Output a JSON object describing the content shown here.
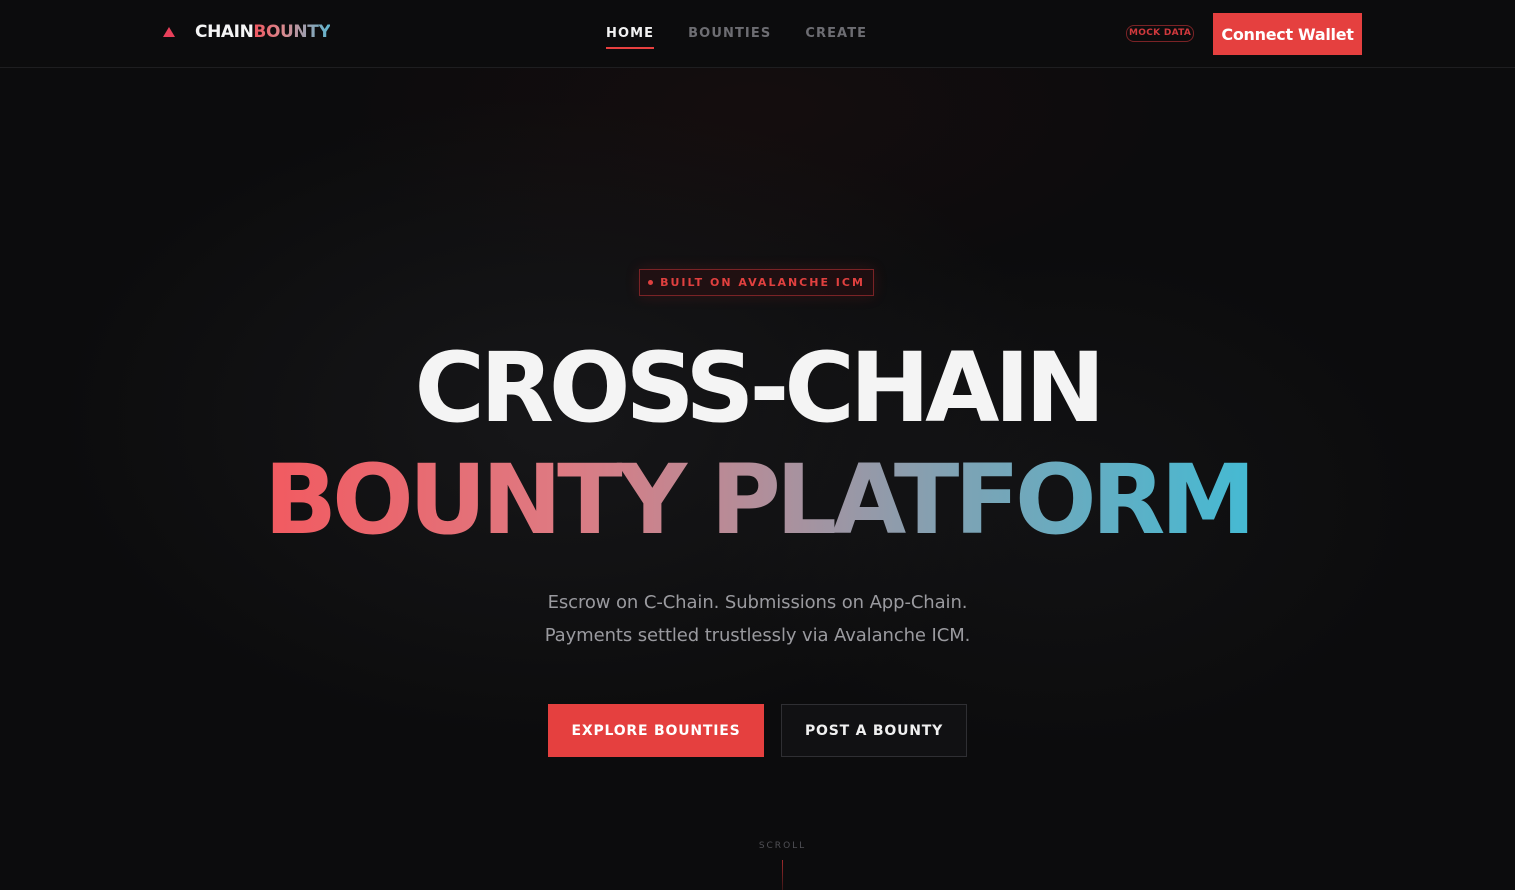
{
  "brand": {
    "icon": "triangle-logo-icon",
    "name_part1": "CHAIN",
    "name_part2": "BOUNTY",
    "accent_color": "#e8405a"
  },
  "nav": {
    "items": [
      {
        "label": "HOME",
        "active": true
      },
      {
        "label": "BOUNTIES",
        "active": false
      },
      {
        "label": "CREATE",
        "active": false
      }
    ]
  },
  "header": {
    "mock_badge": "MOCK DATA",
    "connect_label": "Connect Wallet"
  },
  "hero": {
    "tag": "BUILT ON AVALANCHE ICM",
    "headline_line1": "CROSS-CHAIN",
    "headline_line2": "BOUNTY PLATFORM",
    "subtitle_line1": "Escrow on C-Chain. Submissions on App-Chain.",
    "subtitle_line2": "Payments settled trustlessly via Avalanche ICM.",
    "primary_cta": "EXPLORE BOUNTIES",
    "secondary_cta": "POST A BOUNTY",
    "scroll_label": "SCROLL"
  },
  "colors": {
    "accent": "#e5403f",
    "background": "#0c0c0d",
    "gradient_start": "#f25a60",
    "gradient_end": "#45bad3"
  }
}
